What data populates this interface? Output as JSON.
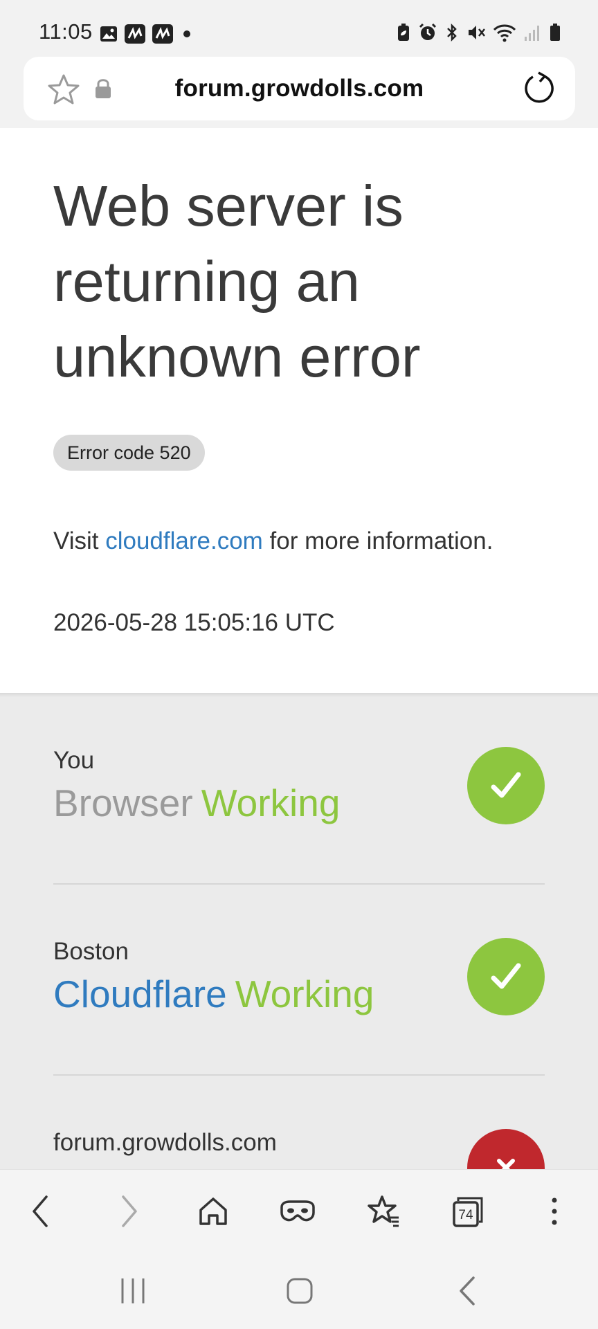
{
  "status_bar": {
    "time": "11:05",
    "left_icons": [
      "gallery-icon",
      "app-icon",
      "app-icon",
      "dot-icon"
    ],
    "right_icons": [
      "battery-saver-icon",
      "alarm-icon",
      "bluetooth-icon",
      "mute-icon",
      "wifi-icon",
      "signal-icon",
      "battery-icon"
    ]
  },
  "url_bar": {
    "url": "forum.growdolls.com"
  },
  "page": {
    "headline": "Web server is returning an unknown error",
    "error_code": "Error code 520",
    "visit_prefix": "Visit ",
    "visit_link": "cloudflare.com",
    "visit_suffix": " for more information.",
    "timestamp": "2026-05-28 15:05:16 UTC"
  },
  "nodes": [
    {
      "location": "You",
      "name": "Browser",
      "status": "Working",
      "state": "ok"
    },
    {
      "location": "Boston",
      "name": "Cloudflare",
      "status": "Working",
      "state": "ok"
    },
    {
      "location": "forum.growdolls.com",
      "name": "",
      "status": "",
      "state": "error"
    }
  ],
  "toolbar": {
    "tab_count": "74",
    "buttons": [
      "back-icon",
      "forward-icon",
      "home-icon",
      "secret-mode-icon",
      "bookmarks-icon",
      "tabs-icon",
      "more-icon"
    ]
  },
  "colors": {
    "accent_blue": "#2f7bbf",
    "working_green": "#8dc63f",
    "error_red": "#c0282d"
  }
}
